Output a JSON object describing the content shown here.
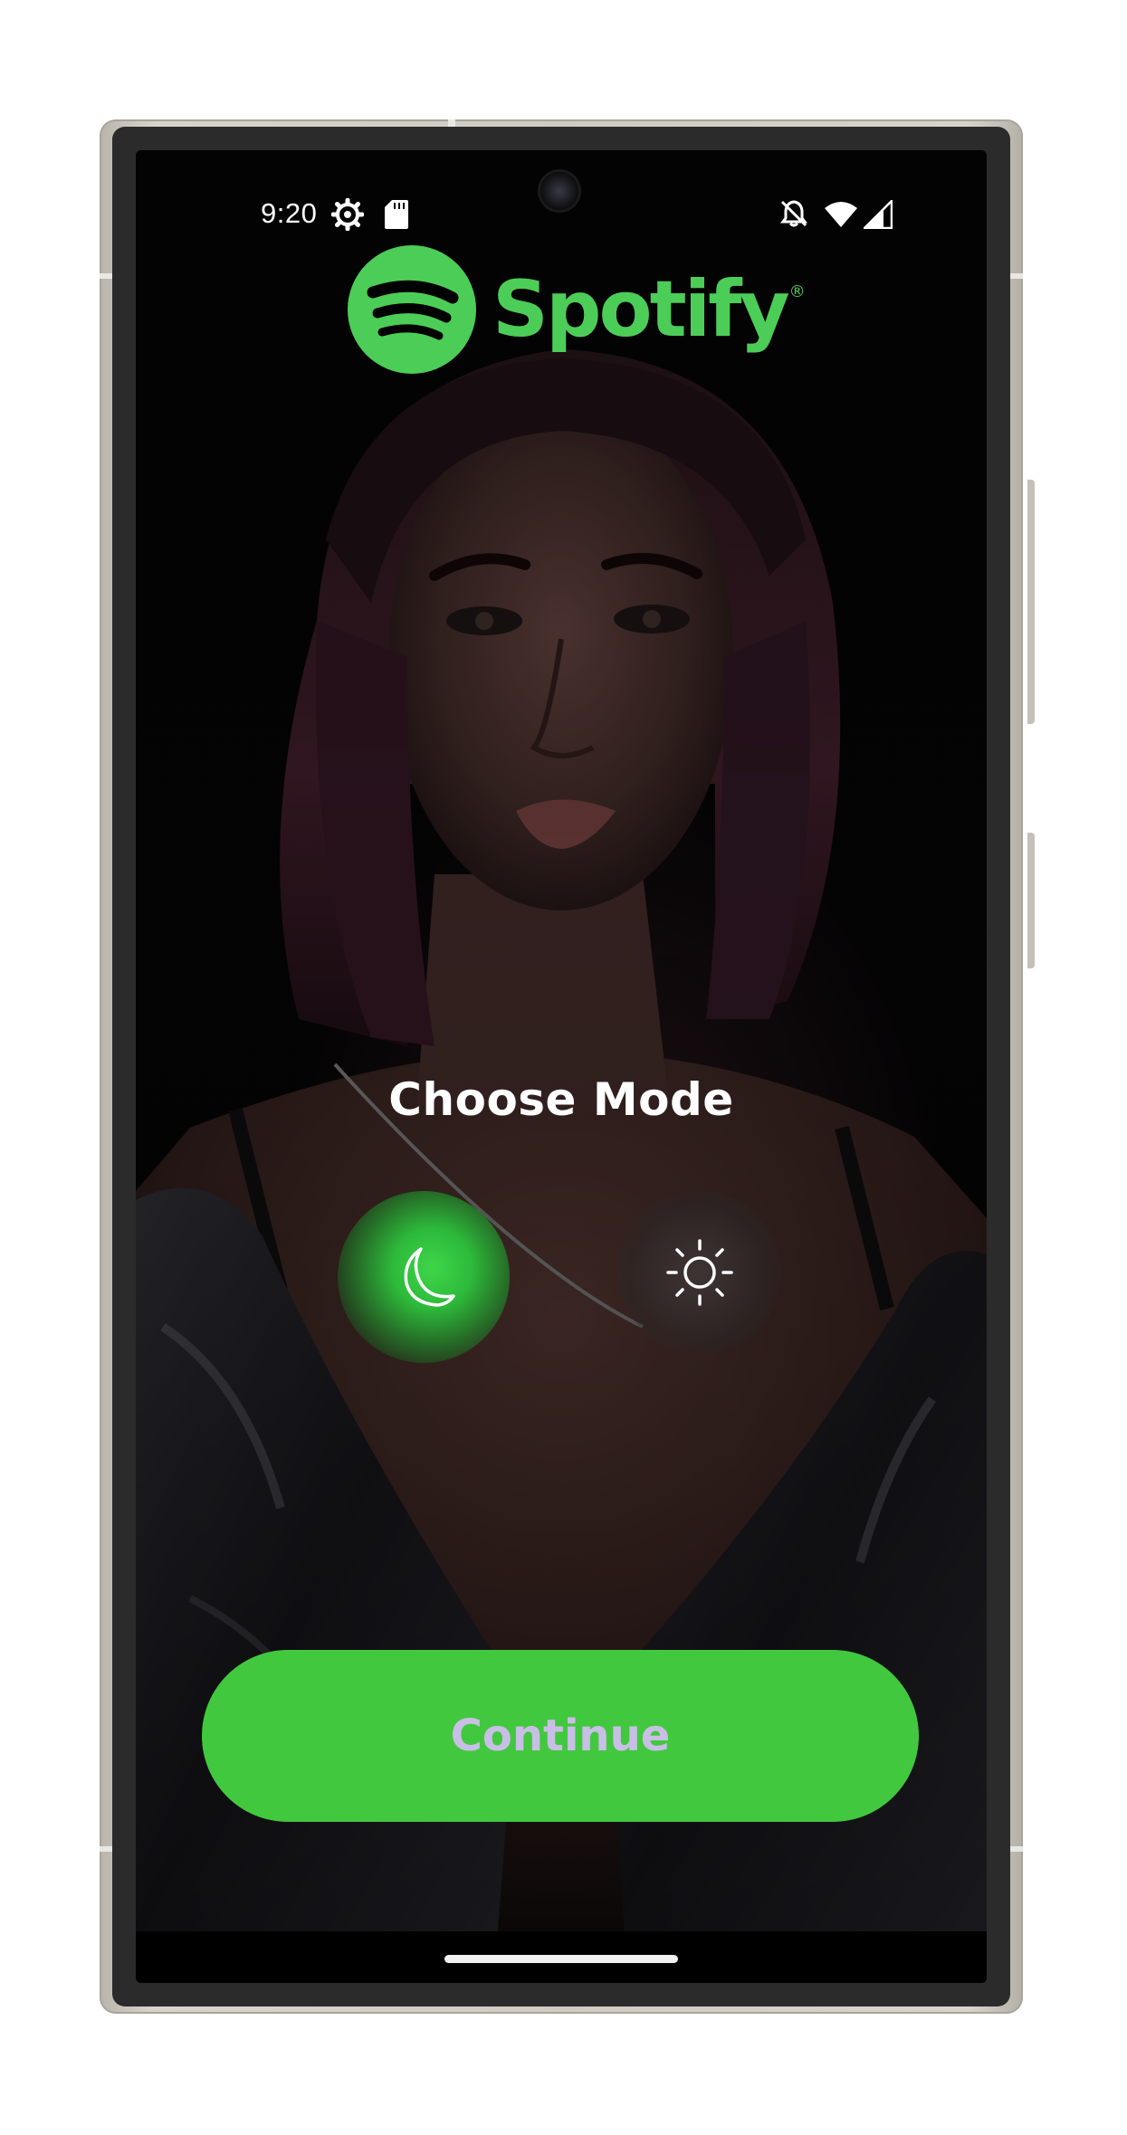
{
  "status_bar": {
    "time": "9:20",
    "icons": [
      "settings-gear-icon",
      "sd-card-icon",
      "notifications-off-icon",
      "wifi-icon",
      "cellular-signal-icon"
    ]
  },
  "logo": {
    "wordmark": "Spotify",
    "registered": "®",
    "brand_color": "#4ccd57"
  },
  "mode_picker": {
    "title": "Choose Mode",
    "options": [
      {
        "icon": "moon-icon",
        "selected": true
      },
      {
        "icon": "sun-icon",
        "selected": false
      }
    ],
    "accent_color": "#3fd64a"
  },
  "continue_button": {
    "label": "Continue",
    "background": "#42c83f",
    "text_color": "#c9bfe6"
  }
}
